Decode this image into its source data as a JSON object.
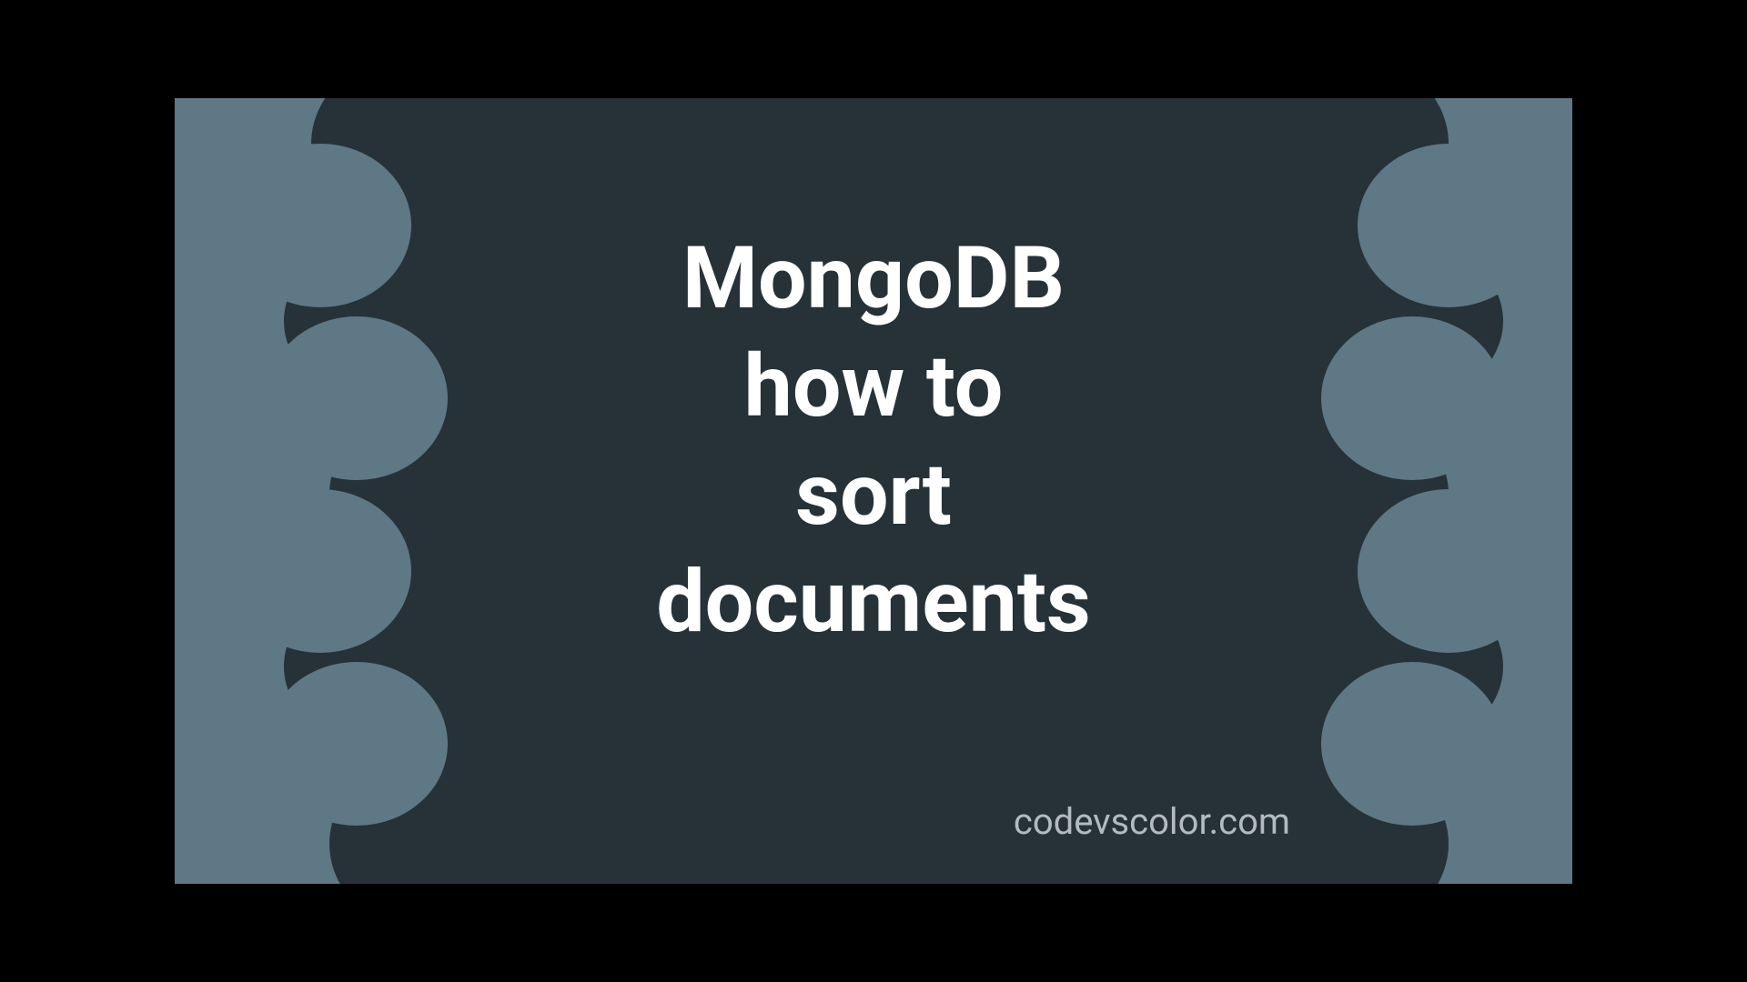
{
  "title": {
    "line1": "MongoDB",
    "line2": "how to",
    "line3": "sort",
    "line4": "documents"
  },
  "watermark": "codevscolor.com",
  "colors": {
    "background": "#5f7886",
    "blob": "#263238",
    "text": "#ffffff",
    "watermark": "#b1bbc0"
  }
}
